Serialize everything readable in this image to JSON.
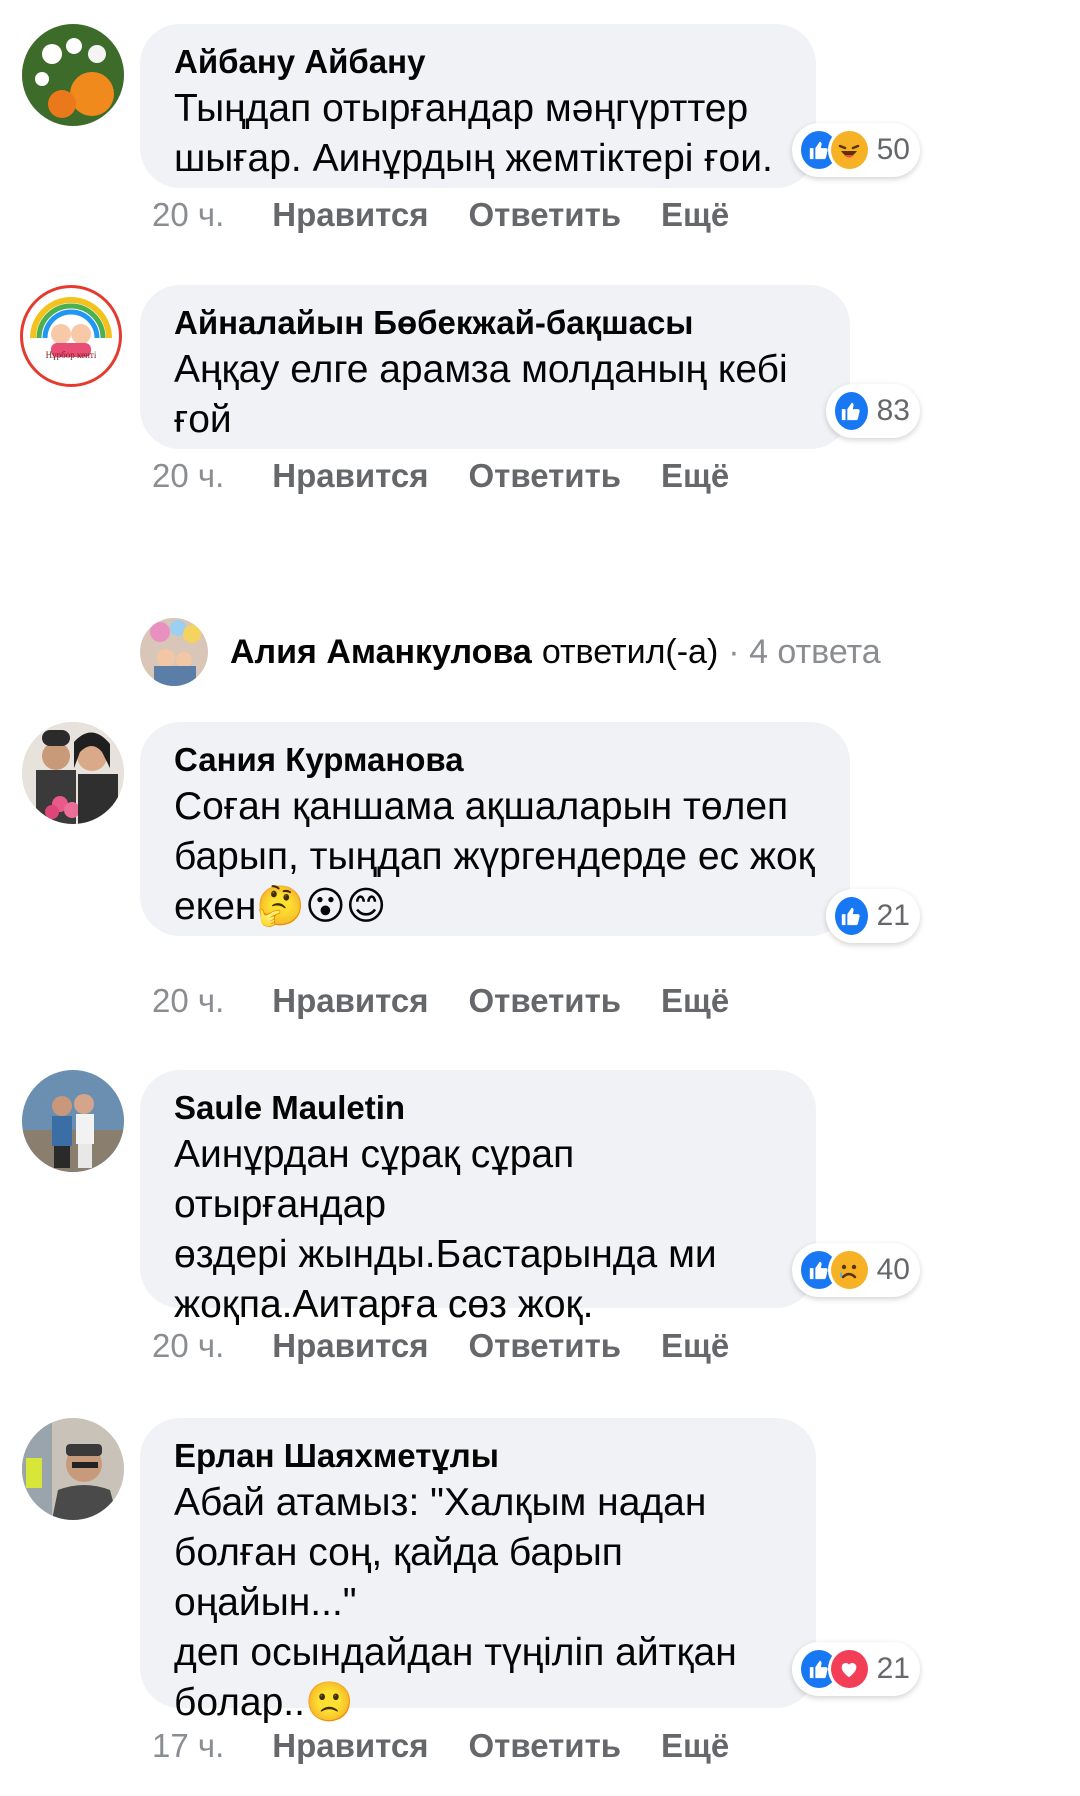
{
  "comments": [
    {
      "author": "Айбану Айбану",
      "text": "Тыңдап отырғандар мәңгүрттер\nшығар. Аинұрдың жемтіктері ғои.",
      "reaction_count": "50",
      "reactions": [
        "like-icon",
        "laughing-emoji-icon"
      ],
      "time": "20 ч.",
      "like": "Нравится",
      "reply": "Ответить",
      "more": "Ещё"
    },
    {
      "author": "Айналайын Бөбекжай-бақшасы",
      "text": "Аңқау елге арамза молданың кебі\nғой",
      "reaction_count": "83",
      "reactions": [
        "like-icon"
      ],
      "time": "20 ч.",
      "like": "Нравится",
      "reply": "Ответить",
      "more": "Ещё",
      "avatar_caption": "Нұрбор кенті"
    },
    {
      "author": "Сания Курманова",
      "text": "Соған қаншама ақшаларын төлеп\nбарып, тыңдап жүргендерде ес жоқ\nекен🤔😮😊",
      "reaction_count": "21",
      "reactions": [
        "like-icon"
      ],
      "time": "20 ч.",
      "like": "Нравится",
      "reply": "Ответить",
      "more": "Ещё"
    },
    {
      "author": "Saule Mauletin",
      "text": "Аинұрдан сұрақ сұрап отырғандар\nөздері жынды.Бастарында ми\nжоқпа.Аитарға сөз жоқ.",
      "reaction_count": "40",
      "reactions": [
        "like-icon",
        "sad-emoji-icon"
      ],
      "time": "20 ч.",
      "like": "Нравится",
      "reply": "Ответить",
      "more": "Ещё"
    },
    {
      "author": "Ерлан Шаяхметұлы",
      "text": "Абай атамыз: \"Халқым надан\nболған соң, қайда барып оңайын...\"\nдеп осындайдан түңіліп айтқан\nболар..🙁",
      "reaction_count": "21",
      "reactions": [
        "like-icon",
        "heart-icon"
      ],
      "time": "17 ч.",
      "like": "Нравится",
      "reply": "Ответить",
      "more": "Ещё"
    }
  ],
  "reply_summary": {
    "name": "Алия Аманкулова",
    "verb": "ответил(-а)",
    "count": "· 4 ответа"
  },
  "colors": {
    "like_blue": "#1877f2",
    "love_red": "#f33e58",
    "haha_yellow": "#f7b125",
    "bubble_bg": "#f0f2f5",
    "meta_gray": "#65676b"
  }
}
